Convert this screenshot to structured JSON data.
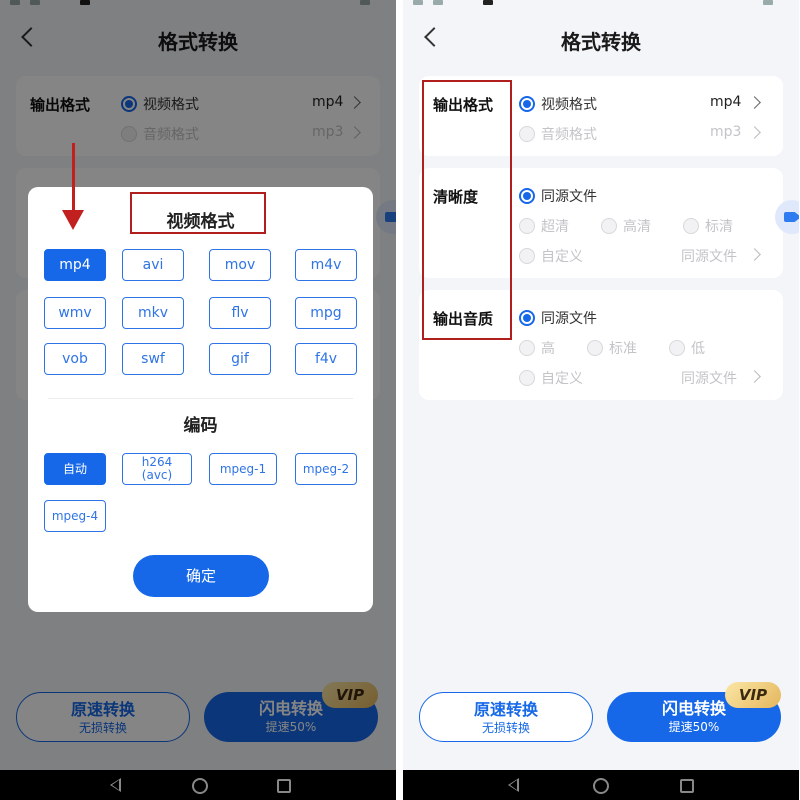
{
  "title": "格式转换",
  "output_format": {
    "label": "输出格式",
    "video": {
      "label": "视频格式",
      "value": "mp4"
    },
    "audio": {
      "label": "音频格式",
      "value": "mp3"
    }
  },
  "clarity": {
    "label": "清晰度",
    "source": "同源文件",
    "options": [
      "超清",
      "高清",
      "标清"
    ],
    "custom": "自定义",
    "custom_value": "同源文件"
  },
  "audio_quality": {
    "label": "输出音质",
    "source": "同源文件",
    "options": [
      "高",
      "标准",
      "低"
    ],
    "custom": "自定义",
    "custom_value": "同源文件"
  },
  "buttons": {
    "slow": {
      "main": "原速转换",
      "sub": "无损转换"
    },
    "fast": {
      "main": "闪电转换",
      "sub": "提速50%"
    },
    "vip": "VIP"
  },
  "dialog": {
    "format_title": "视频格式",
    "formats": [
      "mp4",
      "avi",
      "mov",
      "m4v",
      "wmv",
      "mkv",
      "flv",
      "mpg",
      "vob",
      "swf",
      "gif",
      "f4v"
    ],
    "selected_format": "mp4",
    "codec_title": "编码",
    "codecs": [
      "自动",
      "h264 (avc)",
      "mpeg-1",
      "mpeg-2",
      "mpeg-4"
    ],
    "selected_codec": "自动",
    "confirm": "确定"
  },
  "colors": {
    "accent": "#1668e8",
    "annotation": "#b01e1e"
  },
  "icons": [
    "back-arrow-icon",
    "chevron-right-icon",
    "video-camera-icon",
    "nav-back-icon",
    "nav-home-icon",
    "nav-recents-icon"
  ]
}
